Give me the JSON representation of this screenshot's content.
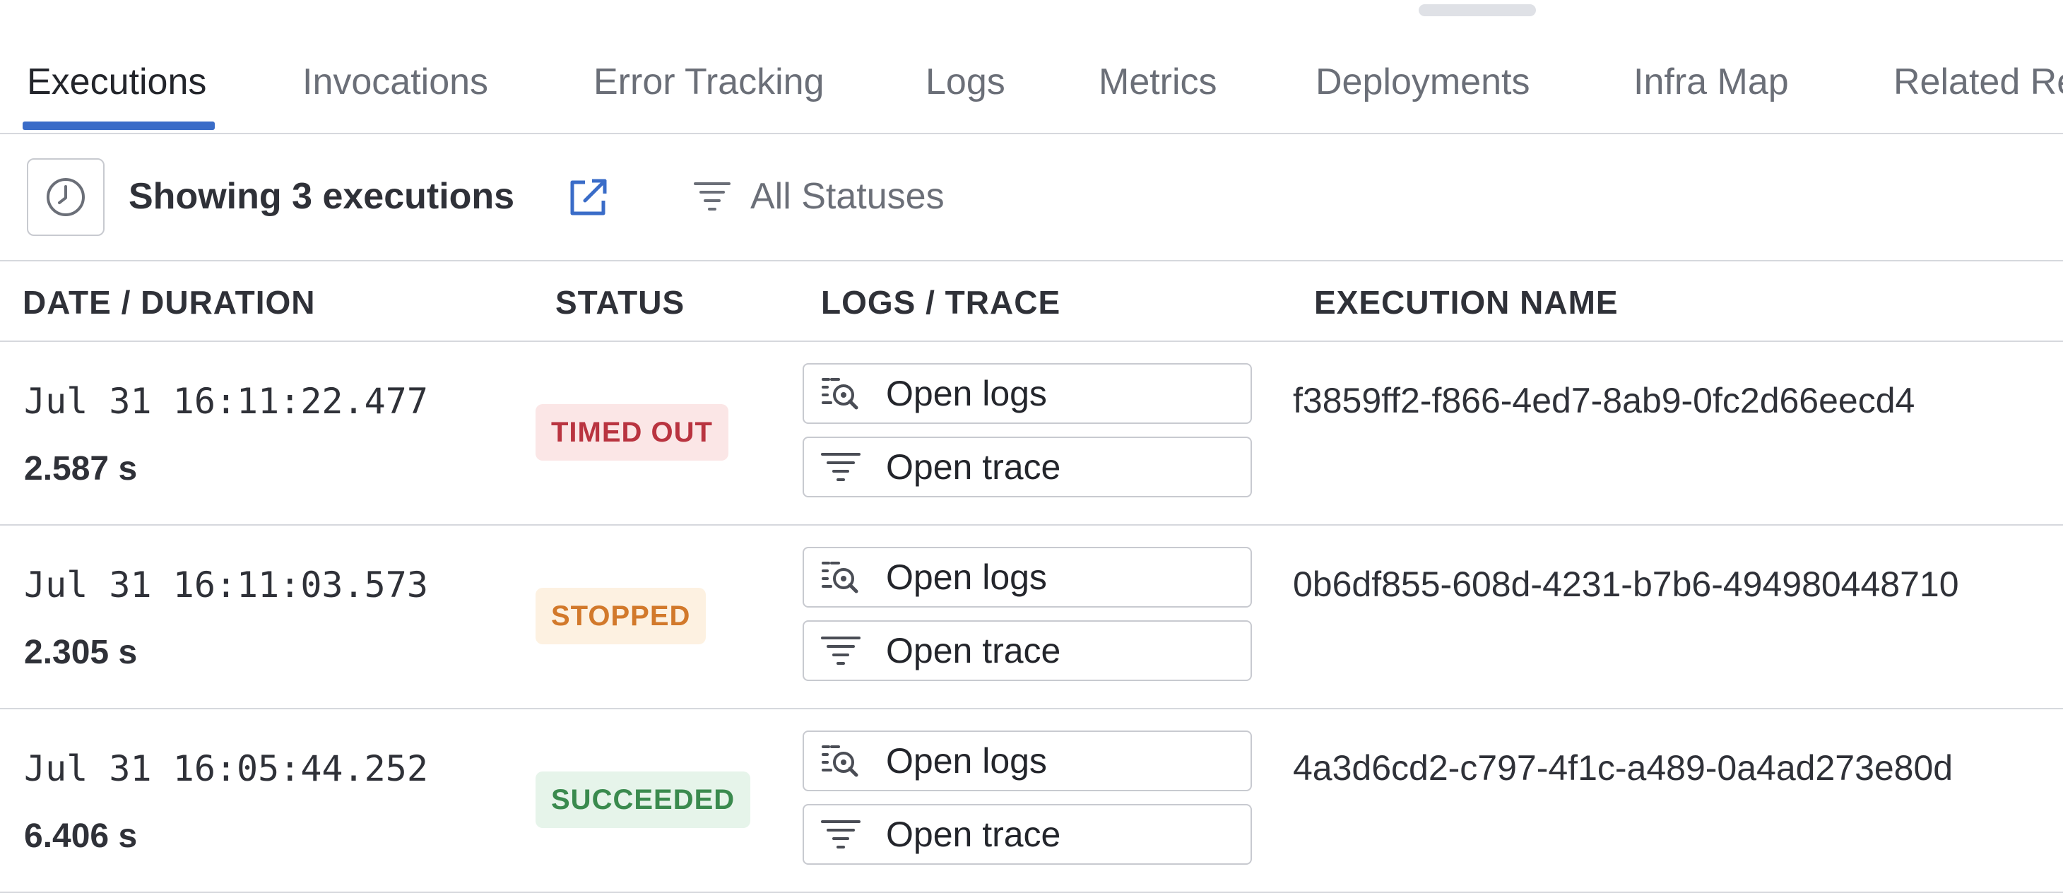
{
  "tabs": [
    {
      "label": "Executions",
      "active": true
    },
    {
      "label": "Invocations",
      "active": false
    },
    {
      "label": "Error Tracking",
      "active": false
    },
    {
      "label": "Logs",
      "active": false
    },
    {
      "label": "Metrics",
      "active": false
    },
    {
      "label": "Deployments",
      "active": false
    },
    {
      "label": "Infra Map",
      "active": false
    },
    {
      "label": "Related Re",
      "active": false
    }
  ],
  "toolbar": {
    "clock_icon": "clock-icon",
    "showing_label": "Showing 3 executions",
    "export_icon": "external-link-icon",
    "filter_icon": "filter-icon",
    "status_filter_label": "All Statuses"
  },
  "table": {
    "headers": [
      "DATE / DURATION",
      "STATUS",
      "LOGS / TRACE",
      "EXECUTION NAME"
    ],
    "rows": [
      {
        "date": "Jul 31 16:11:22.477",
        "duration": "2.587 s",
        "status": "TIMED OUT",
        "logs_label": "Open logs",
        "trace_label": "Open trace",
        "execution_name": "f3859ff2-f866-4ed7-8ab9-0fc2d66eecd4"
      },
      {
        "date": "Jul 31 16:11:03.573",
        "duration": "2.305 s",
        "status": "STOPPED",
        "logs_label": "Open logs",
        "trace_label": "Open trace",
        "execution_name": "0b6df855-608d-4231-b7b6-494980448710"
      },
      {
        "date": "Jul 31 16:05:44.252",
        "duration": "6.406 s",
        "status": "SUCCEEDED",
        "logs_label": "Open logs",
        "trace_label": "Open trace",
        "execution_name": "4a3d6cd2-c797-4f1c-a489-0a4ad273e80d"
      }
    ]
  },
  "colors": {
    "accent": "#3a6cc8",
    "timed_out": "#b93440",
    "stopped": "#d2792b",
    "succeeded": "#3a8a4e"
  }
}
